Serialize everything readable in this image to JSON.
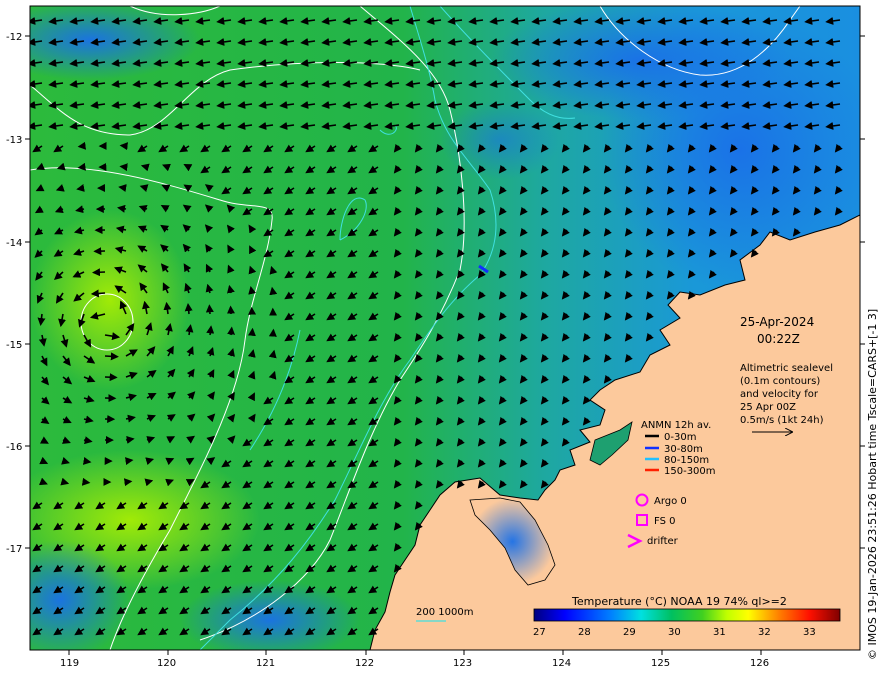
{
  "map": {
    "lat_labels": [
      "-12",
      "-13",
      "-14",
      "-15",
      "-16",
      "-17"
    ],
    "lon_labels": [
      "119",
      "120",
      "121",
      "122",
      "123",
      "124",
      "125",
      "126"
    ],
    "date": "25-Apr-2024",
    "time": "00:22Z",
    "description_lines": [
      "Altimetric sealevel",
      "(0.1m contours)",
      "and velocity for",
      "25 Apr 00Z",
      "0.5m/s (1kt 24h)"
    ],
    "credit": "© IMOS 19-Jan-2026 23:51:26 Hobart time Tscale=CARS+[-1 3]"
  },
  "legend": {
    "title": "ANMN 12h av.",
    "items": [
      {
        "label": "0-30m",
        "color": "#000000"
      },
      {
        "label": "30-80m",
        "color": "#1030ff"
      },
      {
        "label": "80-150m",
        "color": "#20c0ff"
      },
      {
        "label": "150-300m",
        "color": "#ff2000"
      }
    ],
    "argo_label": "Argo 0",
    "fs_label": "FS 0",
    "drifter_label": "drifter",
    "marker_color": "#ff00ff",
    "isobath_label": "200  1000m",
    "isobath_color": "#40e0e0"
  },
  "colorbar": {
    "title": "Temperature (°C) NOAA 19 74% ql>=2",
    "ticks": [
      "27",
      "28",
      "29",
      "30",
      "31",
      "32",
      "33"
    ],
    "colors": [
      "#00007f",
      "#0000ff",
      "#007fff",
      "#00ffff",
      "#00c060",
      "#20c020",
      "#7fff00",
      "#ffff00",
      "#ff7f00",
      "#ff0000",
      "#7f0000"
    ]
  },
  "colors": {
    "land": "#fcc99c",
    "sea_base": "#22b840",
    "sea_cool": "#1a9fd8",
    "contour": "#ffffff",
    "isobath": "#40e0e0"
  }
}
